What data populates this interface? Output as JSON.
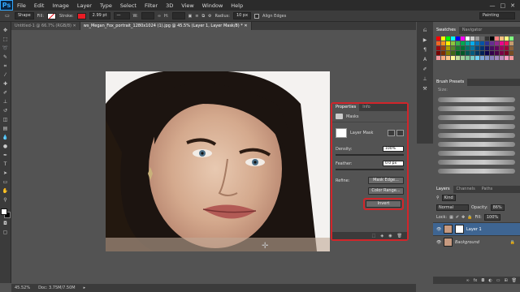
{
  "menu": [
    "File",
    "Edit",
    "Image",
    "Layer",
    "Type",
    "Select",
    "Filter",
    "3D",
    "View",
    "Window",
    "Help"
  ],
  "options": {
    "tool_mode": "Shape",
    "fill_label": "Fill:",
    "stroke_label": "Stroke:",
    "stroke_color": "#e81c25",
    "stroke_width": "2.99 pt",
    "w_label": "W:",
    "h_label": "H:",
    "radius_label": "Radius:",
    "radius_value": "10 px",
    "align_edges": "Align Edges",
    "workspace": "Painting"
  },
  "tabs": [
    "Untitled-1 @ 66.7% (RGB/8)",
    "ws_Megan_Fox_portrait_1280x1024 (1).jpg @ 45.5% (Layer 1, Layer Mask/8) *"
  ],
  "status": {
    "zoom": "45.52%",
    "doc": "Doc: 3.75M/7.50M"
  },
  "properties": {
    "tab_active": "Properties",
    "tab_other": "Info",
    "section": "Masks",
    "mask_type": "Layer Mask",
    "density_label": "Density:",
    "density_value": "100%",
    "feather_label": "Feather:",
    "feather_value": "0.0 px",
    "refine_label": "Refine:",
    "mask_edge_btn": "Mask Edge...",
    "color_range_btn": "Color Range...",
    "invert_btn": "Invert"
  },
  "swatches_panel": {
    "tab_active": "Swatches",
    "tab_other": "Navigator"
  },
  "brush_panel": {
    "title": "Brush Presets",
    "size_label": "Size:"
  },
  "layers_panel": {
    "tabs": [
      "Layers",
      "Channels",
      "Paths"
    ],
    "kind": "Kind",
    "blend_mode": "Normal",
    "opacity_label": "Opacity:",
    "opacity_value": "86%",
    "lock_label": "Lock:",
    "fill_label": "Fill:",
    "fill_value": "100%",
    "layers": [
      {
        "name": "Layer 1",
        "selected": true
      },
      {
        "name": "Background",
        "selected": false
      }
    ]
  },
  "swatch_colors": [
    "#ff0000",
    "#ffff00",
    "#00ff00",
    "#00ffff",
    "#0000ff",
    "#ff00ff",
    "#ffffff",
    "#cccccc",
    "#999999",
    "#666666",
    "#333333",
    "#000000",
    "#ff7f7f",
    "#ffbf7f",
    "#ffff7f",
    "#7fff7f",
    "#f26522",
    "#f7941d",
    "#fff200",
    "#8dc63f",
    "#39b54a",
    "#00a651",
    "#00a99d",
    "#00aeef",
    "#0072bc",
    "#0054a6",
    "#2e3192",
    "#662d91",
    "#92278f",
    "#ec008c",
    "#ed145b",
    "#c69c6d",
    "#9e0b0f",
    "#a0410d",
    "#aba000",
    "#598527",
    "#197b30",
    "#007236",
    "#00746b",
    "#0076a3",
    "#004a80",
    "#003471",
    "#1b1464",
    "#440e62",
    "#630460",
    "#9e005d",
    "#9e0039",
    "#8c6239",
    "#790000",
    "#7b2e00",
    "#827b00",
    "#406618",
    "#005e20",
    "#005826",
    "#005952",
    "#005b7f",
    "#003663",
    "#002157",
    "#0d004c",
    "#32004b",
    "#4b0049",
    "#7b0046",
    "#7a0026",
    "#754c24",
    "#f6989d",
    "#f9ad81",
    "#fdc68a",
    "#fff79a",
    "#c4df9b",
    "#a3d39c",
    "#82ca9c",
    "#7accc8",
    "#6dcff6",
    "#7da7d9",
    "#8393ca",
    "#8781bd",
    "#a186be",
    "#bd8cbf",
    "#f49ac1",
    "#f5989d"
  ]
}
